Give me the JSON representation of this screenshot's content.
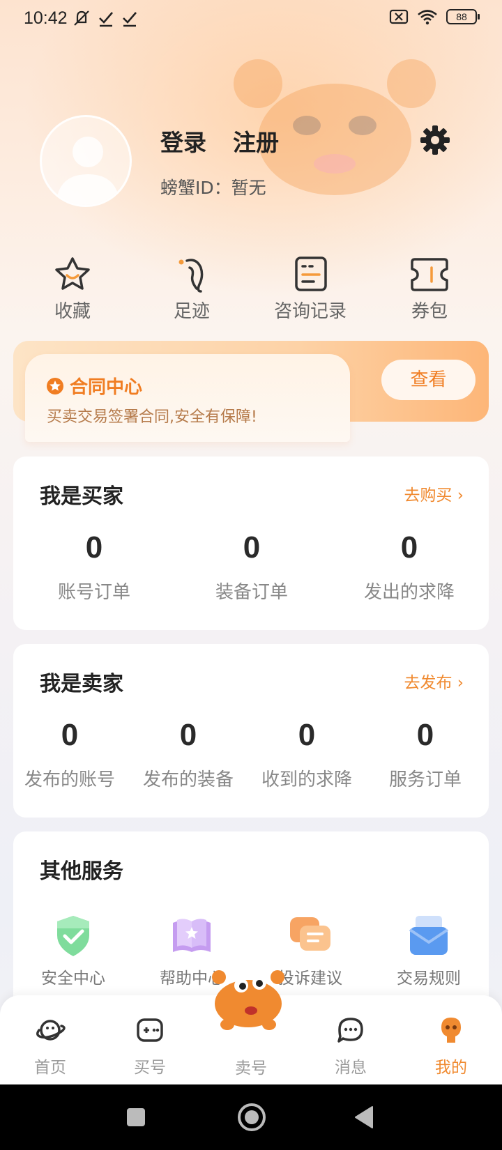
{
  "status_bar": {
    "time": "10:42",
    "battery": "88"
  },
  "profile": {
    "login": "登录",
    "register": "注册",
    "crab_id": "螃蟹ID：暂无"
  },
  "quick_actions": [
    {
      "label": "收藏",
      "icon": "star-icon"
    },
    {
      "label": "足迹",
      "icon": "footprint-icon"
    },
    {
      "label": "咨询记录",
      "icon": "record-icon"
    },
    {
      "label": "券包",
      "icon": "coupon-icon"
    }
  ],
  "contract": {
    "title": "合同中心",
    "subtitle": "买卖交易签署合同,安全有保障!",
    "button": "查看"
  },
  "buyer": {
    "title": "我是买家",
    "link": "去购买 ›",
    "stats": [
      {
        "value": "0",
        "label": "账号订单"
      },
      {
        "value": "0",
        "label": "装备订单"
      },
      {
        "value": "0",
        "label": "发出的求降"
      }
    ]
  },
  "seller": {
    "title": "我是卖家",
    "link": "去发布 ›",
    "stats": [
      {
        "value": "0",
        "label": "发布的账号"
      },
      {
        "value": "0",
        "label": "发布的装备"
      },
      {
        "value": "0",
        "label": "收到的求降"
      },
      {
        "value": "0",
        "label": "服务订单"
      }
    ]
  },
  "services": {
    "title": "其他服务",
    "items": [
      {
        "label": "安全中心",
        "icon": "shield-icon"
      },
      {
        "label": "帮助中心",
        "icon": "help-book-icon"
      },
      {
        "label": "投诉建议",
        "icon": "complaint-icon"
      },
      {
        "label": "交易规则",
        "icon": "rules-icon"
      }
    ]
  },
  "tabs": [
    {
      "label": "首页",
      "icon": "home-planet-icon"
    },
    {
      "label": "买号",
      "icon": "gamepad-icon"
    },
    {
      "label": "卖号",
      "icon": "crab-icon"
    },
    {
      "label": "消息",
      "icon": "message-icon"
    },
    {
      "label": "我的",
      "icon": "profile-icon",
      "active": true
    }
  ],
  "colors": {
    "accent": "#f08a30",
    "banner": "#fdb678"
  }
}
